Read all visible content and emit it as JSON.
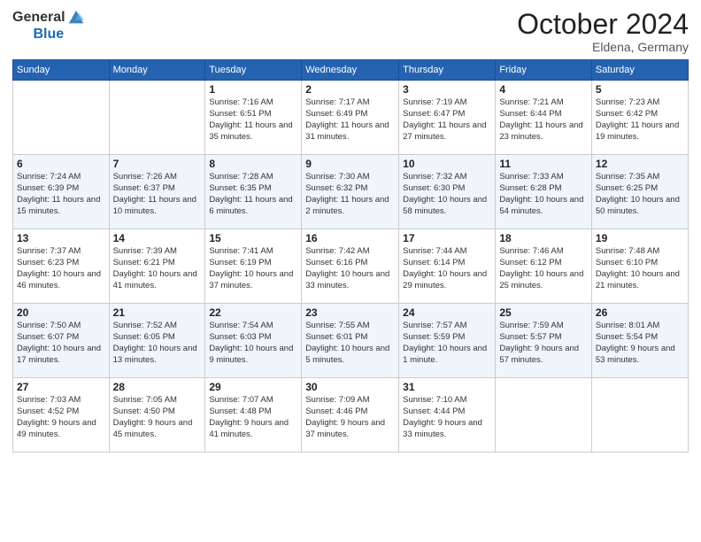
{
  "header": {
    "logo_general": "General",
    "logo_blue": "Blue",
    "month": "October 2024",
    "location": "Eldena, Germany"
  },
  "weekdays": [
    "Sunday",
    "Monday",
    "Tuesday",
    "Wednesday",
    "Thursday",
    "Friday",
    "Saturday"
  ],
  "rows": [
    [
      {
        "day": "",
        "info": ""
      },
      {
        "day": "",
        "info": ""
      },
      {
        "day": "1",
        "info": "Sunrise: 7:16 AM\nSunset: 6:51 PM\nDaylight: 11 hours and 35 minutes."
      },
      {
        "day": "2",
        "info": "Sunrise: 7:17 AM\nSunset: 6:49 PM\nDaylight: 11 hours and 31 minutes."
      },
      {
        "day": "3",
        "info": "Sunrise: 7:19 AM\nSunset: 6:47 PM\nDaylight: 11 hours and 27 minutes."
      },
      {
        "day": "4",
        "info": "Sunrise: 7:21 AM\nSunset: 6:44 PM\nDaylight: 11 hours and 23 minutes."
      },
      {
        "day": "5",
        "info": "Sunrise: 7:23 AM\nSunset: 6:42 PM\nDaylight: 11 hours and 19 minutes."
      }
    ],
    [
      {
        "day": "6",
        "info": "Sunrise: 7:24 AM\nSunset: 6:39 PM\nDaylight: 11 hours and 15 minutes."
      },
      {
        "day": "7",
        "info": "Sunrise: 7:26 AM\nSunset: 6:37 PM\nDaylight: 11 hours and 10 minutes."
      },
      {
        "day": "8",
        "info": "Sunrise: 7:28 AM\nSunset: 6:35 PM\nDaylight: 11 hours and 6 minutes."
      },
      {
        "day": "9",
        "info": "Sunrise: 7:30 AM\nSunset: 6:32 PM\nDaylight: 11 hours and 2 minutes."
      },
      {
        "day": "10",
        "info": "Sunrise: 7:32 AM\nSunset: 6:30 PM\nDaylight: 10 hours and 58 minutes."
      },
      {
        "day": "11",
        "info": "Sunrise: 7:33 AM\nSunset: 6:28 PM\nDaylight: 10 hours and 54 minutes."
      },
      {
        "day": "12",
        "info": "Sunrise: 7:35 AM\nSunset: 6:25 PM\nDaylight: 10 hours and 50 minutes."
      }
    ],
    [
      {
        "day": "13",
        "info": "Sunrise: 7:37 AM\nSunset: 6:23 PM\nDaylight: 10 hours and 46 minutes."
      },
      {
        "day": "14",
        "info": "Sunrise: 7:39 AM\nSunset: 6:21 PM\nDaylight: 10 hours and 41 minutes."
      },
      {
        "day": "15",
        "info": "Sunrise: 7:41 AM\nSunset: 6:19 PM\nDaylight: 10 hours and 37 minutes."
      },
      {
        "day": "16",
        "info": "Sunrise: 7:42 AM\nSunset: 6:16 PM\nDaylight: 10 hours and 33 minutes."
      },
      {
        "day": "17",
        "info": "Sunrise: 7:44 AM\nSunset: 6:14 PM\nDaylight: 10 hours and 29 minutes."
      },
      {
        "day": "18",
        "info": "Sunrise: 7:46 AM\nSunset: 6:12 PM\nDaylight: 10 hours and 25 minutes."
      },
      {
        "day": "19",
        "info": "Sunrise: 7:48 AM\nSunset: 6:10 PM\nDaylight: 10 hours and 21 minutes."
      }
    ],
    [
      {
        "day": "20",
        "info": "Sunrise: 7:50 AM\nSunset: 6:07 PM\nDaylight: 10 hours and 17 minutes."
      },
      {
        "day": "21",
        "info": "Sunrise: 7:52 AM\nSunset: 6:05 PM\nDaylight: 10 hours and 13 minutes."
      },
      {
        "day": "22",
        "info": "Sunrise: 7:54 AM\nSunset: 6:03 PM\nDaylight: 10 hours and 9 minutes."
      },
      {
        "day": "23",
        "info": "Sunrise: 7:55 AM\nSunset: 6:01 PM\nDaylight: 10 hours and 5 minutes."
      },
      {
        "day": "24",
        "info": "Sunrise: 7:57 AM\nSunset: 5:59 PM\nDaylight: 10 hours and 1 minute."
      },
      {
        "day": "25",
        "info": "Sunrise: 7:59 AM\nSunset: 5:57 PM\nDaylight: 9 hours and 57 minutes."
      },
      {
        "day": "26",
        "info": "Sunrise: 8:01 AM\nSunset: 5:54 PM\nDaylight: 9 hours and 53 minutes."
      }
    ],
    [
      {
        "day": "27",
        "info": "Sunrise: 7:03 AM\nSunset: 4:52 PM\nDaylight: 9 hours and 49 minutes."
      },
      {
        "day": "28",
        "info": "Sunrise: 7:05 AM\nSunset: 4:50 PM\nDaylight: 9 hours and 45 minutes."
      },
      {
        "day": "29",
        "info": "Sunrise: 7:07 AM\nSunset: 4:48 PM\nDaylight: 9 hours and 41 minutes."
      },
      {
        "day": "30",
        "info": "Sunrise: 7:09 AM\nSunset: 4:46 PM\nDaylight: 9 hours and 37 minutes."
      },
      {
        "day": "31",
        "info": "Sunrise: 7:10 AM\nSunset: 4:44 PM\nDaylight: 9 hours and 33 minutes."
      },
      {
        "day": "",
        "info": ""
      },
      {
        "day": "",
        "info": ""
      }
    ]
  ]
}
